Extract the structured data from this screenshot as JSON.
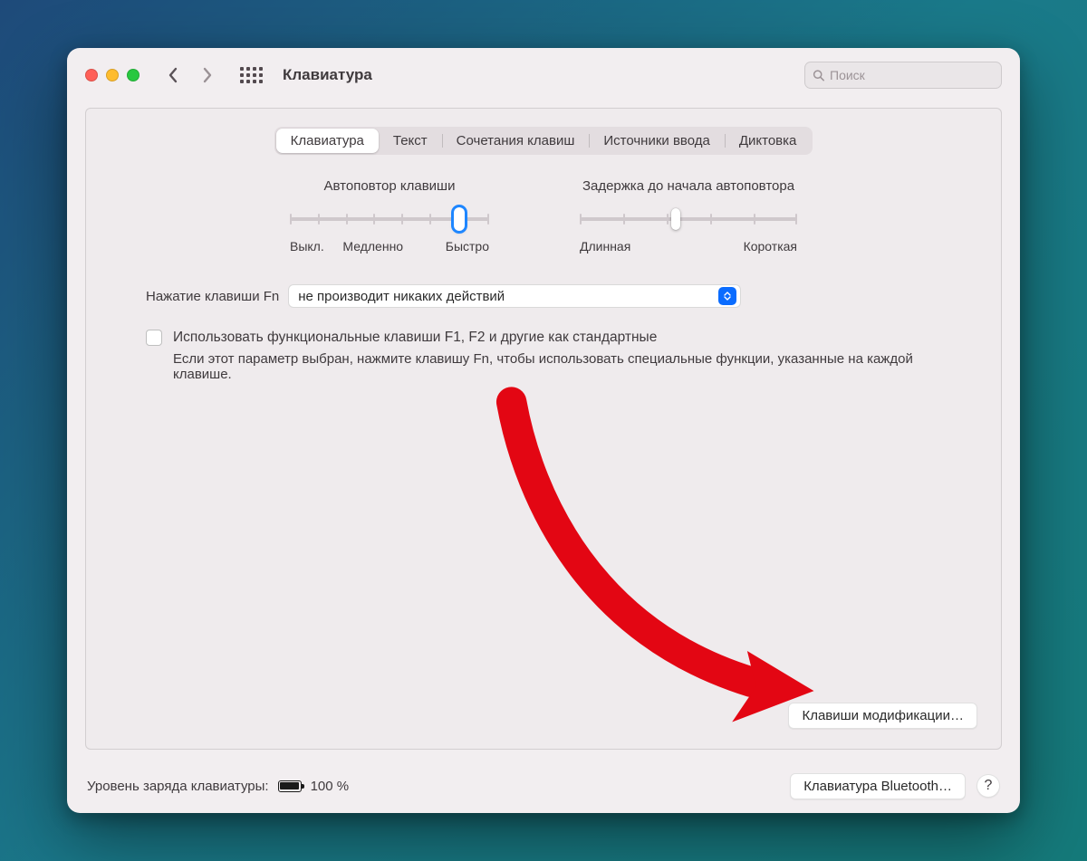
{
  "window": {
    "title": "Клавиатура"
  },
  "search": {
    "placeholder": "Поиск"
  },
  "tabs": [
    "Клавиатура",
    "Текст",
    "Сочетания клавиш",
    "Источники ввода",
    "Диктовка"
  ],
  "slider_repeat": {
    "title": "Автоповтор клавиши",
    "left": "Выкл.",
    "mid": "Медленно",
    "right": "Быстро"
  },
  "slider_delay": {
    "title": "Задержка до начала автоповтора",
    "left": "Длинная",
    "right": "Короткая"
  },
  "fn": {
    "label": "Нажатие клавиши Fn",
    "selected": "не производит никаких действий"
  },
  "std_keys": {
    "label": "Использовать функциональные клавиши F1, F2 и другие как стандартные",
    "desc": "Если этот параметр выбран, нажмите клавишу Fn, чтобы использовать специальные функции, указанные на каждой клавише."
  },
  "modifier_button": "Клавиши модификации…",
  "footer": {
    "battery_label": "Уровень заряда клавиатуры:",
    "battery_pct": "100 %",
    "bluetooth_button": "Клавиатура Bluetooth…",
    "help": "?"
  }
}
